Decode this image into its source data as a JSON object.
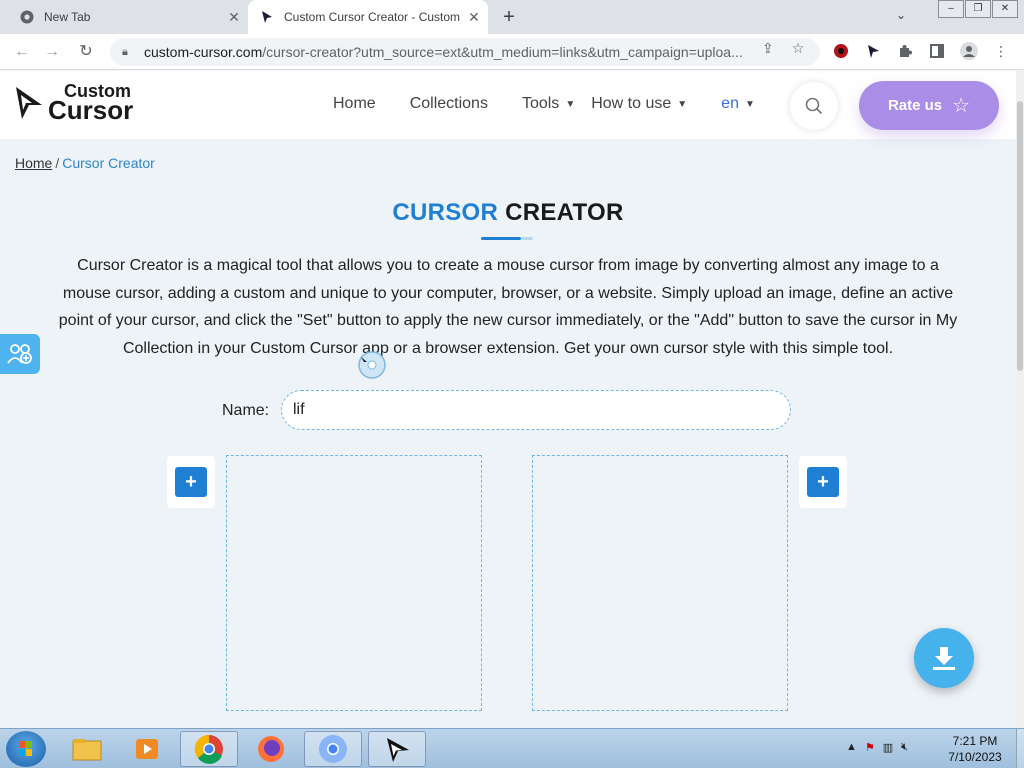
{
  "browser": {
    "tabs": [
      {
        "title": "New Tab",
        "active": false
      },
      {
        "title": "Custom Cursor Creator - Custom",
        "active": true
      }
    ],
    "url_domain": "custom-cursor.com",
    "url_path": "/cursor-creator?utm_source=ext&utm_medium=links&utm_campaign=uploa..."
  },
  "site": {
    "logo_top": "Custom",
    "logo_bottom": "Cursor",
    "nav": {
      "home": "Home",
      "collections": "Collections",
      "tools": "Tools",
      "how_to_use": "How to use",
      "lang": "en"
    },
    "rate_label": "Rate us"
  },
  "breadcrumb": {
    "home": "Home",
    "separator": "/",
    "current": "Cursor Creator"
  },
  "heading": {
    "part1": "CURSOR",
    "part2": "CREATOR"
  },
  "description": "Cursor Creator is a magical tool that allows you to create a mouse cursor from image by converting almost any image to a mouse cursor, adding a custom and unique to your computer, browser, or a website. Simply upload an image, define an active point of your cursor, and click the \"Set\" button to apply the new cursor immediately, or the \"Add\" button to save the cursor in My Collection in your Custom Cursor app or a browser extension. Get your own cursor style with this simple tool.",
  "form": {
    "name_label": "Name:",
    "name_value": "lif",
    "plus_label": "+"
  },
  "taskbar": {
    "time": "7:21 PM",
    "date": "7/10/2023"
  },
  "colors": {
    "accent_blue": "#1e7fd3",
    "rate_purple": "#a98de6",
    "download_blue": "#45b2ec"
  }
}
